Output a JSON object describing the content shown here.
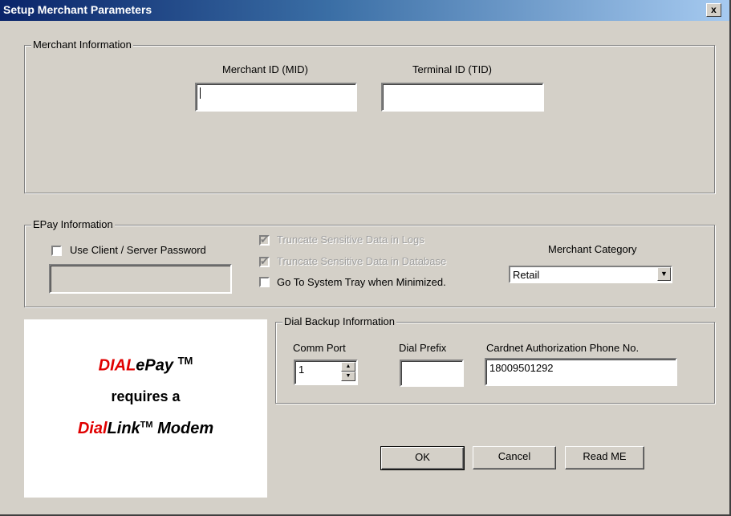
{
  "window": {
    "title": "Setup Merchant Parameters",
    "close_label": "x"
  },
  "merchant": {
    "legend": "Merchant Information",
    "mid_label": "Merchant ID (MID)",
    "mid_value": "",
    "tid_label": "Terminal ID (TID)",
    "tid_value": ""
  },
  "epay": {
    "legend": "EPay Information",
    "use_password_label": "Use Client / Server Password",
    "truncate_logs_label": "Truncate Sensitive Data in Logs",
    "truncate_db_label": "Truncate Sensitive Data in Database",
    "system_tray_label": "Go To System Tray when Minimized.",
    "category_label": "Merchant Category",
    "category_value": "Retail"
  },
  "dial": {
    "legend": "Dial Backup Information",
    "comm_port_label": "Comm Port",
    "comm_port_value": "1",
    "dial_prefix_label": "Dial Prefix",
    "dial_prefix_value": "",
    "phone_label": "Cardnet Authorization Phone No.",
    "phone_value": "18009501292"
  },
  "banner": {
    "line1_red": "DIAL",
    "line1_black": "ePay",
    "line1_tm": "TM",
    "line2": "requires a",
    "line3_red": "Dial",
    "line3_black1": "Link",
    "line3_tm": "TM",
    "line3_black2": "Modem"
  },
  "buttons": {
    "ok": "OK",
    "cancel": "Cancel",
    "readme": "Read ME"
  }
}
